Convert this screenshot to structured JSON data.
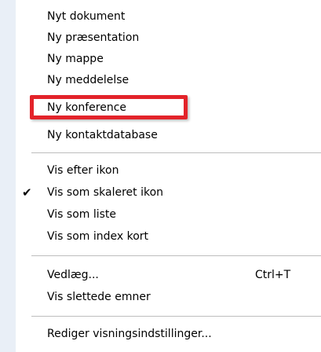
{
  "menu": {
    "items": [
      {
        "label": "Nyt dokument"
      },
      {
        "label": "Ny præsentation"
      },
      {
        "label": "Ny mappe"
      },
      {
        "label": "Ny meddelelse"
      },
      {
        "label": "Ny konference"
      },
      {
        "label": "Ny kontaktdatabase"
      },
      {
        "label": "Vis efter ikon"
      },
      {
        "label": "Vis som skaleret ikon",
        "checked": true
      },
      {
        "label": "Vis som liste"
      },
      {
        "label": "Vis som index kort"
      },
      {
        "label": "Vedlæg...",
        "shortcut": "Ctrl+T"
      },
      {
        "label": "Vis slettede emner"
      },
      {
        "label": "Rediger visningsindstillinger..."
      }
    ],
    "check_glyph": "✔"
  },
  "colors": {
    "highlight": "#e3232a",
    "gutter": "#e9eff7"
  }
}
